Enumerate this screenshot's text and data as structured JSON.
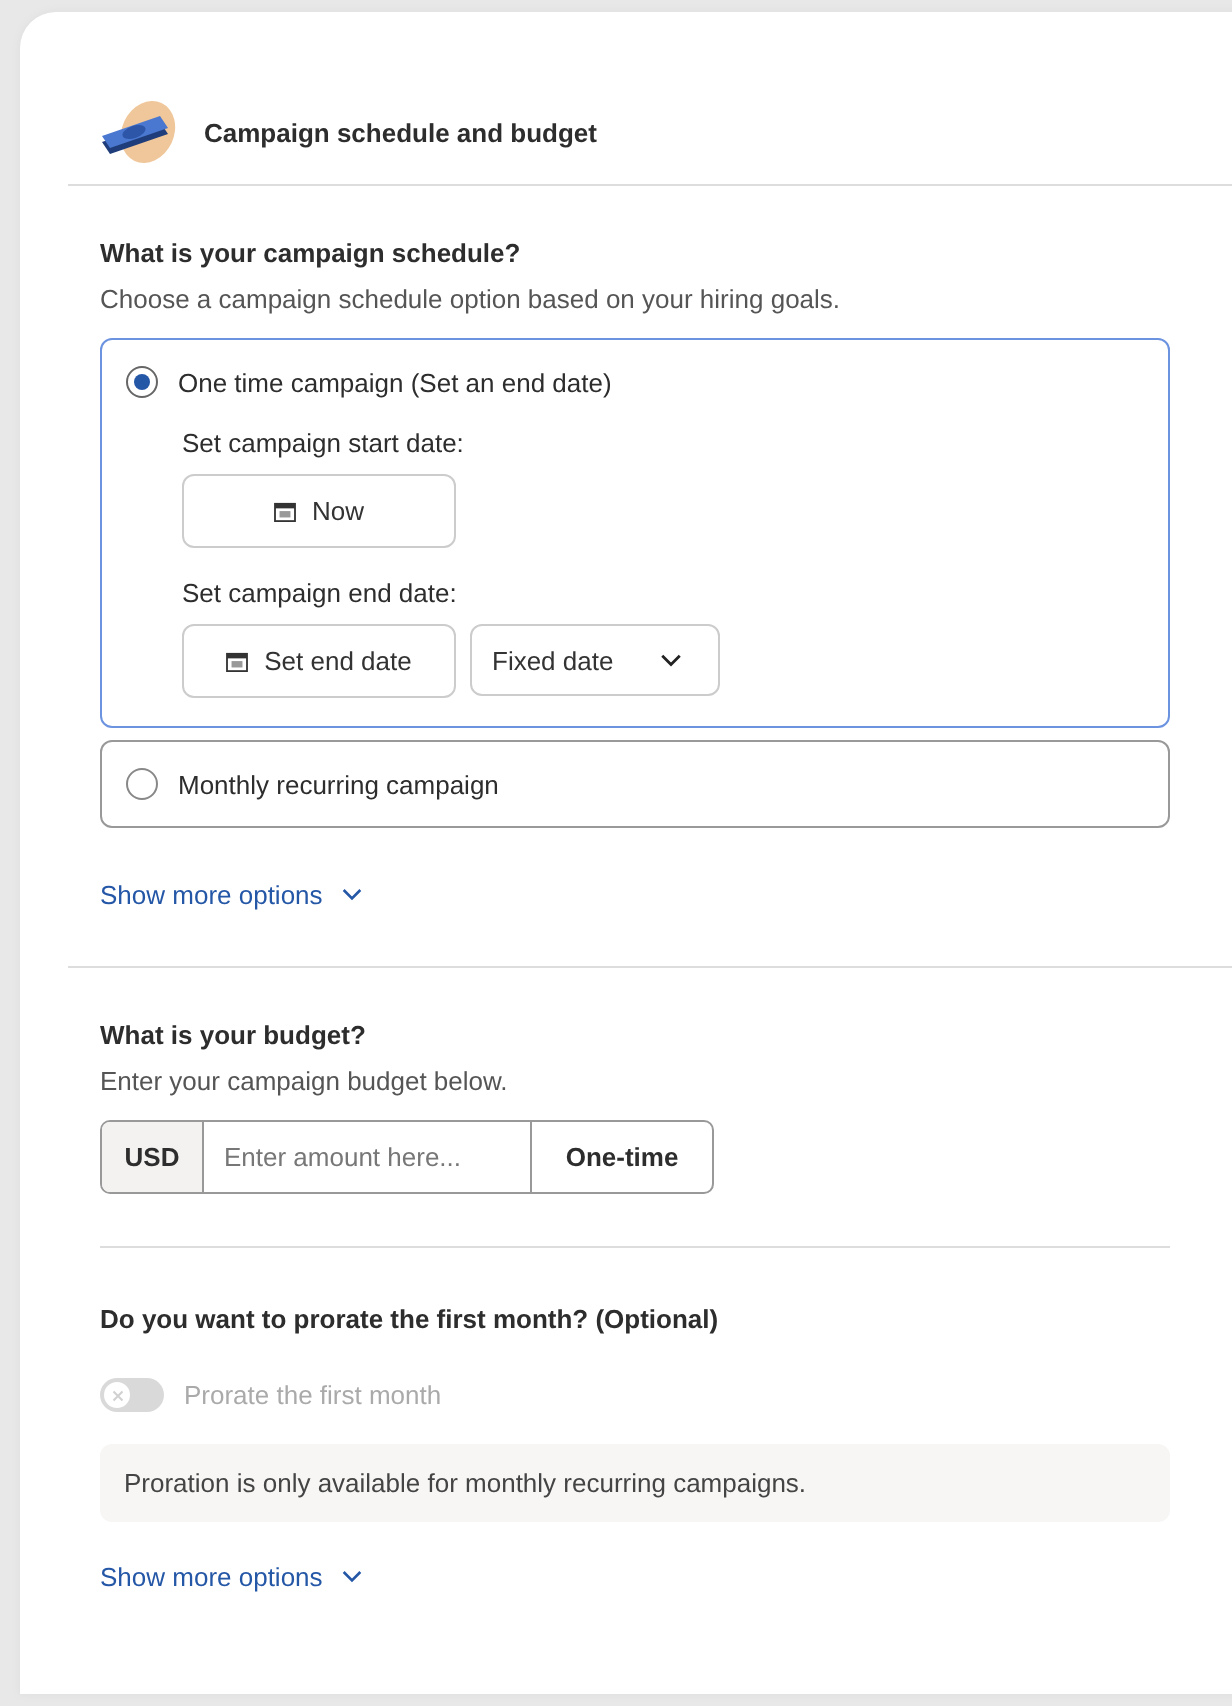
{
  "header": {
    "title": "Campaign schedule and budget"
  },
  "schedule": {
    "heading": "What is your campaign schedule?",
    "description": "Choose a campaign schedule option based on your hiring goals.",
    "options": [
      {
        "label": "One time campaign (Set an end date)",
        "selected": true,
        "start_label": "Set campaign start date:",
        "start_button": "Now",
        "end_label": "Set campaign end date:",
        "end_button": "Set end date",
        "end_type": "Fixed date"
      },
      {
        "label": "Monthly recurring campaign",
        "selected": false
      }
    ],
    "more_link": "Show more options"
  },
  "budget": {
    "heading": "What is your budget?",
    "description": "Enter your campaign budget below.",
    "currency": "USD",
    "placeholder": "Enter amount here...",
    "period": "One-time"
  },
  "proration": {
    "heading": "Do you want to prorate the first month? (Optional)",
    "toggle": {
      "label": "Prorate the first month",
      "on": false,
      "disabled": true
    },
    "notice": "Proration is only available for monthly recurring campaigns.",
    "more_link": "Show more options"
  }
}
